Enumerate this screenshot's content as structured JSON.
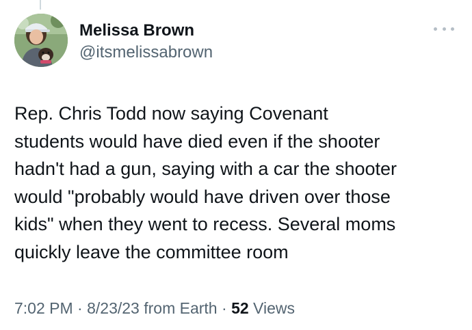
{
  "author": {
    "display_name": "Melissa Brown",
    "handle": "@itsmelissabrown",
    "avatar_icon": "profile-photo-avatar"
  },
  "tweet": {
    "text": "Rep. Chris Todd now saying Covenant\nstudents would have died even if the shooter\nhadn't had a gun, saying with a car the shooter\nwould \"probably would have driven over those\nkids\" when they went to recess. Several moms\nquickly leave the committee room"
  },
  "meta": {
    "time": "7:02 PM",
    "separator": "·",
    "date_source": "8/23/23 from Earth",
    "views_count": "52",
    "views_label": "Views"
  },
  "colors": {
    "text_primary": "#0f1419",
    "text_secondary": "#536471",
    "more_dots": "#b5bec6"
  },
  "icons": {
    "more": "more-horizontal-icon"
  }
}
